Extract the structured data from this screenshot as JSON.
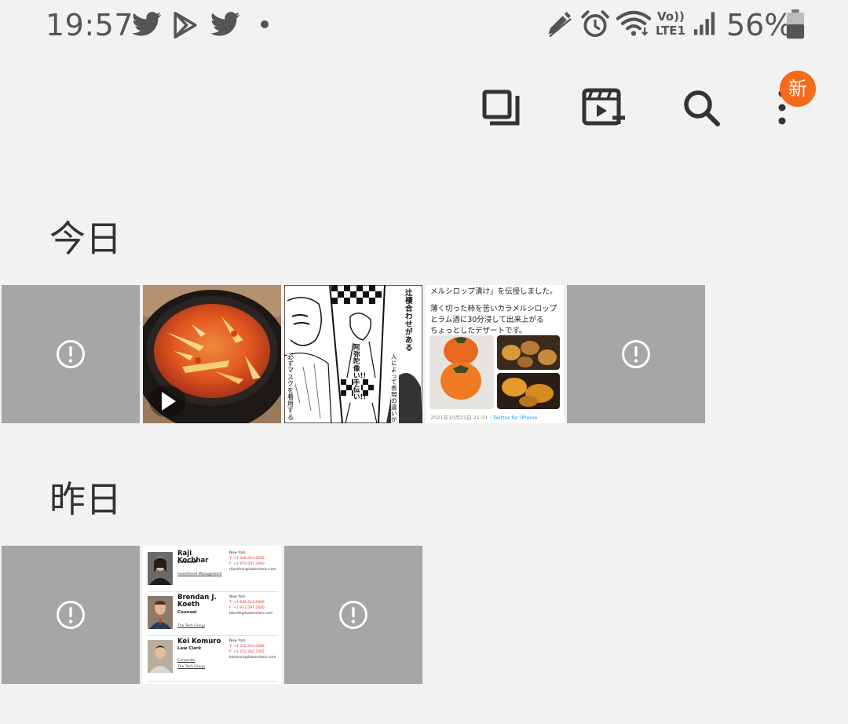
{
  "status_bar": {
    "time": "19:57",
    "icons": [
      "twitter-icon",
      "play-store-icon",
      "twitter-icon",
      "dot-icon",
      "edit-icon",
      "alarm-icon",
      "wifi-icon",
      "volte-lte1-icon",
      "signal-icon",
      "battery-icon"
    ],
    "volte_label": "Vo))",
    "lte_label": "LTE1",
    "battery_percent": "56%"
  },
  "toolbar": {
    "actions": [
      "select-icon",
      "create-video-icon",
      "search-icon",
      "more-icon"
    ],
    "new_badge": "新"
  },
  "sections": {
    "today": {
      "title": "今日",
      "items": [
        "error",
        "video-stew",
        "manga",
        "tweet",
        "error"
      ]
    },
    "yesterday": {
      "title": "昨日",
      "items": [
        "error",
        "contact-cards",
        "error"
      ]
    }
  },
  "tweet": {
    "line1": "メルシロップ漬け」を伝授しました。",
    "line2": "薄く切った柿を苦いカラメルシロップ",
    "line3": "とラム酒に30分浸して出来上がる",
    "line4": "ちょっとしたデザートです。",
    "footer_date": "2021年10月21日 21:01 · ",
    "footer_source": "Twitter for iPhone"
  },
  "manga": {
    "text1": "辻褄合わせがある",
    "text2": "阿弥陀像い!!手伝い!!",
    "text3": "人によって表現の違いが",
    "text4": "必ずマスクを着用する"
  },
  "cards": [
    {
      "name": "Raji Kochhar",
      "role": "Counsel",
      "group": "Investment Management",
      "city": "New York",
      "t": "T: +1 646.414.6958",
      "f": "F: +1 973.597.2400",
      "email": "rkochhar@lowenstein.com"
    },
    {
      "name": "Brendan J. Koeth",
      "role": "Counsel",
      "group": "The Tech Group",
      "city": "New York",
      "t": "T: +1 646.414.6906",
      "f": "F: +1 973.597.2400",
      "email": "bkoeth@lowenstein.com"
    },
    {
      "name": "Kei Komuro",
      "role": "Law Clerk",
      "group": "Corporate",
      "group2": "The Tech Group",
      "city": "New York",
      "t": "T: +1 212.419.5986",
      "f": "F: +1 212.262.7402",
      "email": "kkomuro@lowenstein.com"
    }
  ],
  "colors": {
    "background": "#f2f2f2",
    "error_thumb": "#a7a5a8",
    "badge": "#f26a1b",
    "icon": "#333333"
  }
}
